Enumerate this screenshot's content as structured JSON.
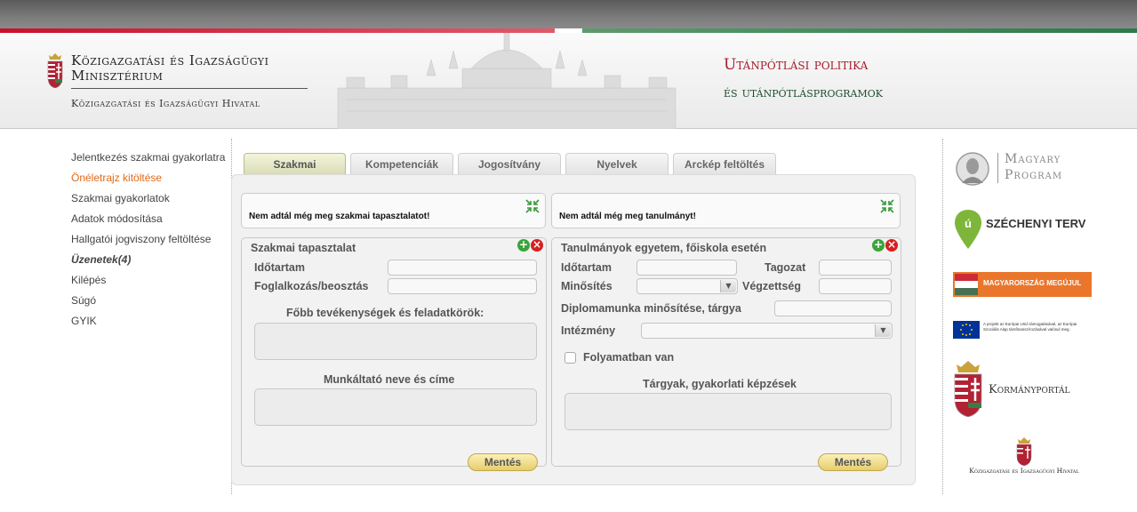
{
  "header": {
    "ministry_line1": "Közigazgatási és Igazságügyi",
    "ministry_line2": "Minisztérium",
    "office": "Közigazgatási és Igazságügyi Hivatal",
    "site_title": "Utánpótlási politika",
    "site_subtitle": "és utánpótlásprogramok"
  },
  "nav": {
    "items": [
      {
        "label": "Jelentkezés szakmai gyakorlatra"
      },
      {
        "label": "Önéletrajz kitöltése"
      },
      {
        "label": "Szakmai gyakorlatok"
      },
      {
        "label": "Adatok módosítása"
      },
      {
        "label": "Hallgatói jogviszony feltöltése"
      },
      {
        "label": "Üzenetek(4)"
      },
      {
        "label": "Kilépés"
      },
      {
        "label": "Súgó"
      },
      {
        "label": "GYIK"
      }
    ]
  },
  "tabs": [
    {
      "label": "Szakmai"
    },
    {
      "label": "Kompetenciák"
    },
    {
      "label": "Jogosítvány"
    },
    {
      "label": "Nyelvek"
    },
    {
      "label": "Arckép feltöltés"
    }
  ],
  "left": {
    "message": "Nem adtál még meg szakmai tapasztalatot!",
    "section_title": "Szakmai tapasztalat",
    "duration_label": "Időtartam",
    "occupation_label": "Foglalkozás/beosztás",
    "activities_label": "Főbb tevékenységek és feladatkörök:",
    "employer_label": "Munkáltató neve és címe",
    "save_label": "Mentés"
  },
  "right": {
    "message": "Nem adtál még meg tanulmányt!",
    "section_title": "Tanulmányok egyetem, főiskola esetén",
    "duration_label": "Időtartam",
    "form_label": "Tagozat",
    "grade_label": "Minősítés",
    "degree_label": "Végzettség",
    "thesis_label": "Diplomamunka minősítése, tárgya",
    "institution_label": "Intézmény",
    "ongoing_label": "Folyamatban van",
    "subjects_label": "Tárgyak, gyakorlati képzések",
    "save_label": "Mentés"
  },
  "sidebar": {
    "magyary_line1": "Magyary",
    "magyary_line2": "Program",
    "szechenyi": "SZÉCHENYI TERV",
    "megujul": "MAGYARORSZÁG MEGÚJUL",
    "eu_text": "A projekt az Európai Unió támogatásával, az Európai Szociális Alap társfinanszírozásával valósul meg.",
    "kormanyportal": "Kormányportál",
    "kih": "Közigazgatási és Igazságügyi Hivatal"
  },
  "colors": {
    "accent": "#e06a1a",
    "title_red": "#a51d2d",
    "title_green": "#1f4d2f"
  }
}
